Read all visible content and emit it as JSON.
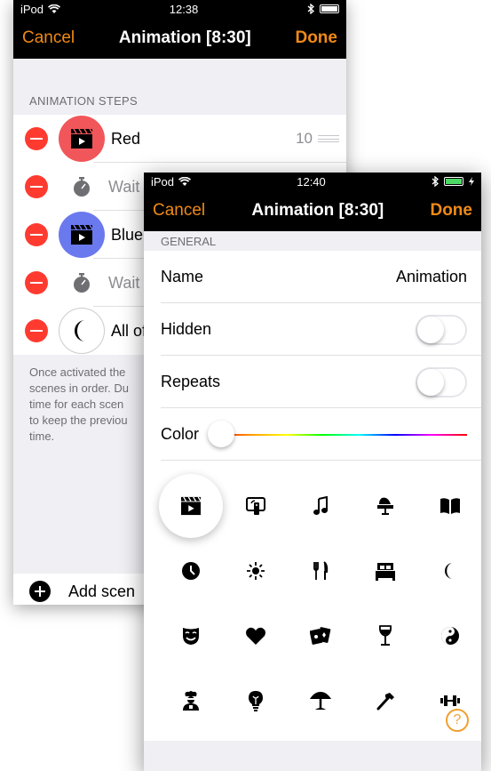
{
  "back_screen": {
    "status": {
      "carrier": "iPod",
      "time": "12:38"
    },
    "nav": {
      "cancel": "Cancel",
      "title": "Animation [8:30]",
      "done": "Done"
    },
    "section_header": "ANIMATION STEPS",
    "steps": [
      {
        "label": "Red",
        "icon": "clapperboard-icon",
        "icon_bg": "#f0565a",
        "value": "10"
      },
      {
        "label": "Wait",
        "icon": "stopwatch-icon"
      },
      {
        "label": "Blue",
        "icon": "clapperboard-icon",
        "icon_bg": "#6b79ef"
      },
      {
        "label": "Wait",
        "icon": "stopwatch-icon"
      },
      {
        "label": "All of",
        "icon": "moon-icon"
      }
    ],
    "footer_lines": [
      "Once activated the",
      "scenes in order. Du",
      "time for each scen",
      "to keep the previou",
      "time."
    ],
    "add_label": "Add scen"
  },
  "front_screen": {
    "status": {
      "carrier": "iPod",
      "time": "12:40"
    },
    "nav": {
      "cancel": "Cancel",
      "title": "Animation [8:30]",
      "done": "Done"
    },
    "section_header": "GENERAL",
    "name_label": "Name",
    "name_value": "Animation",
    "hidden_label": "Hidden",
    "hidden_on": false,
    "repeats_label": "Repeats",
    "repeats_on": false,
    "color_label": "Color",
    "icon_rows": [
      [
        "clapperboard-icon",
        "remote-icon",
        "music-note-icon",
        "iron-icon",
        "book-icon"
      ],
      [
        "clock-icon",
        "sun-icon",
        "fork-knife-icon",
        "bed-icon",
        "moon-icon"
      ],
      [
        "theater-mask-icon",
        "heart-icon",
        "playing-cards-icon",
        "wine-glass-icon",
        "yin-yang-icon"
      ],
      [
        "cook-icon",
        "lightbulb-icon",
        "lamp-icon",
        "hammer-icon",
        "dumbbell-icon"
      ]
    ],
    "selected_icon": "clapperboard-icon",
    "help": "?"
  },
  "colors": {
    "accent": "#f08a16",
    "delete": "#ff3b30",
    "red_scene": "#f0565a",
    "blue_scene": "#6b79ef"
  }
}
